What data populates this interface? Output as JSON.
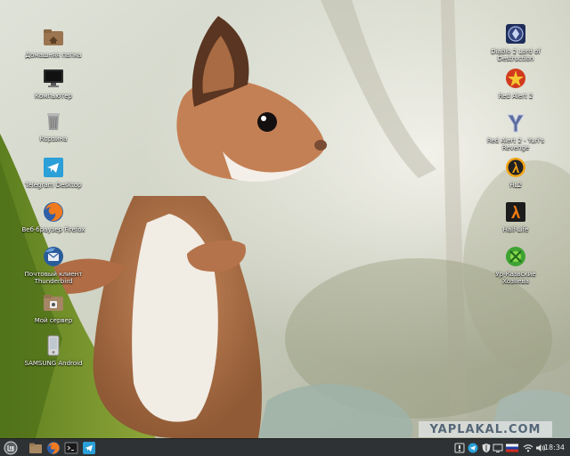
{
  "desktop": {
    "left_icons": [
      {
        "label": "Домашняя папка",
        "icon": "home-folder-icon"
      },
      {
        "label": "Компьютер",
        "icon": "computer-icon"
      },
      {
        "label": "Корзина",
        "icon": "trash-icon"
      },
      {
        "label": "Telegram Desktop",
        "icon": "telegram-icon"
      },
      {
        "label": "Веб-браузер Firefox",
        "icon": "firefox-icon"
      },
      {
        "label": "Почтовый клиент Thunderbird",
        "icon": "thunderbird-icon"
      },
      {
        "label": "Мой сервер",
        "icon": "server-folder-icon"
      },
      {
        "label": "SAMSUNG Android",
        "icon": "android-device-icon"
      }
    ],
    "right_icons": [
      {
        "label": "Diablo 2 Lord of Destruction",
        "icon": "diablo-icon"
      },
      {
        "label": "Red Alert 2",
        "icon": "red-alert-icon"
      },
      {
        "label": "Red Alert 2 - Yuri's Revenge",
        "icon": "yuri-icon"
      },
      {
        "label": "HL2",
        "icon": "half-life-2-icon"
      },
      {
        "label": "Half-Life",
        "icon": "half-life-icon"
      },
      {
        "label": "Ур-Казвские Хозяева",
        "icon": "game-green-icon"
      }
    ]
  },
  "watermark": "YAPLAKAL.COM",
  "panel": {
    "menu_icon": "mint-menu-icon",
    "launchers": [
      "files-icon",
      "firefox-icon",
      "terminal-icon",
      "telegram-icon"
    ],
    "tray": [
      "notifications-icon",
      "telegram-tray-icon",
      "shield-icon",
      "network-icon",
      "keyboard-layout-flag-icon",
      "wifi-icon",
      "volume-icon"
    ],
    "clock": "18:34"
  },
  "colors": {
    "panel_bg": "#2f3234",
    "label_text": "#ffffff",
    "watermark_text": "#556677"
  }
}
